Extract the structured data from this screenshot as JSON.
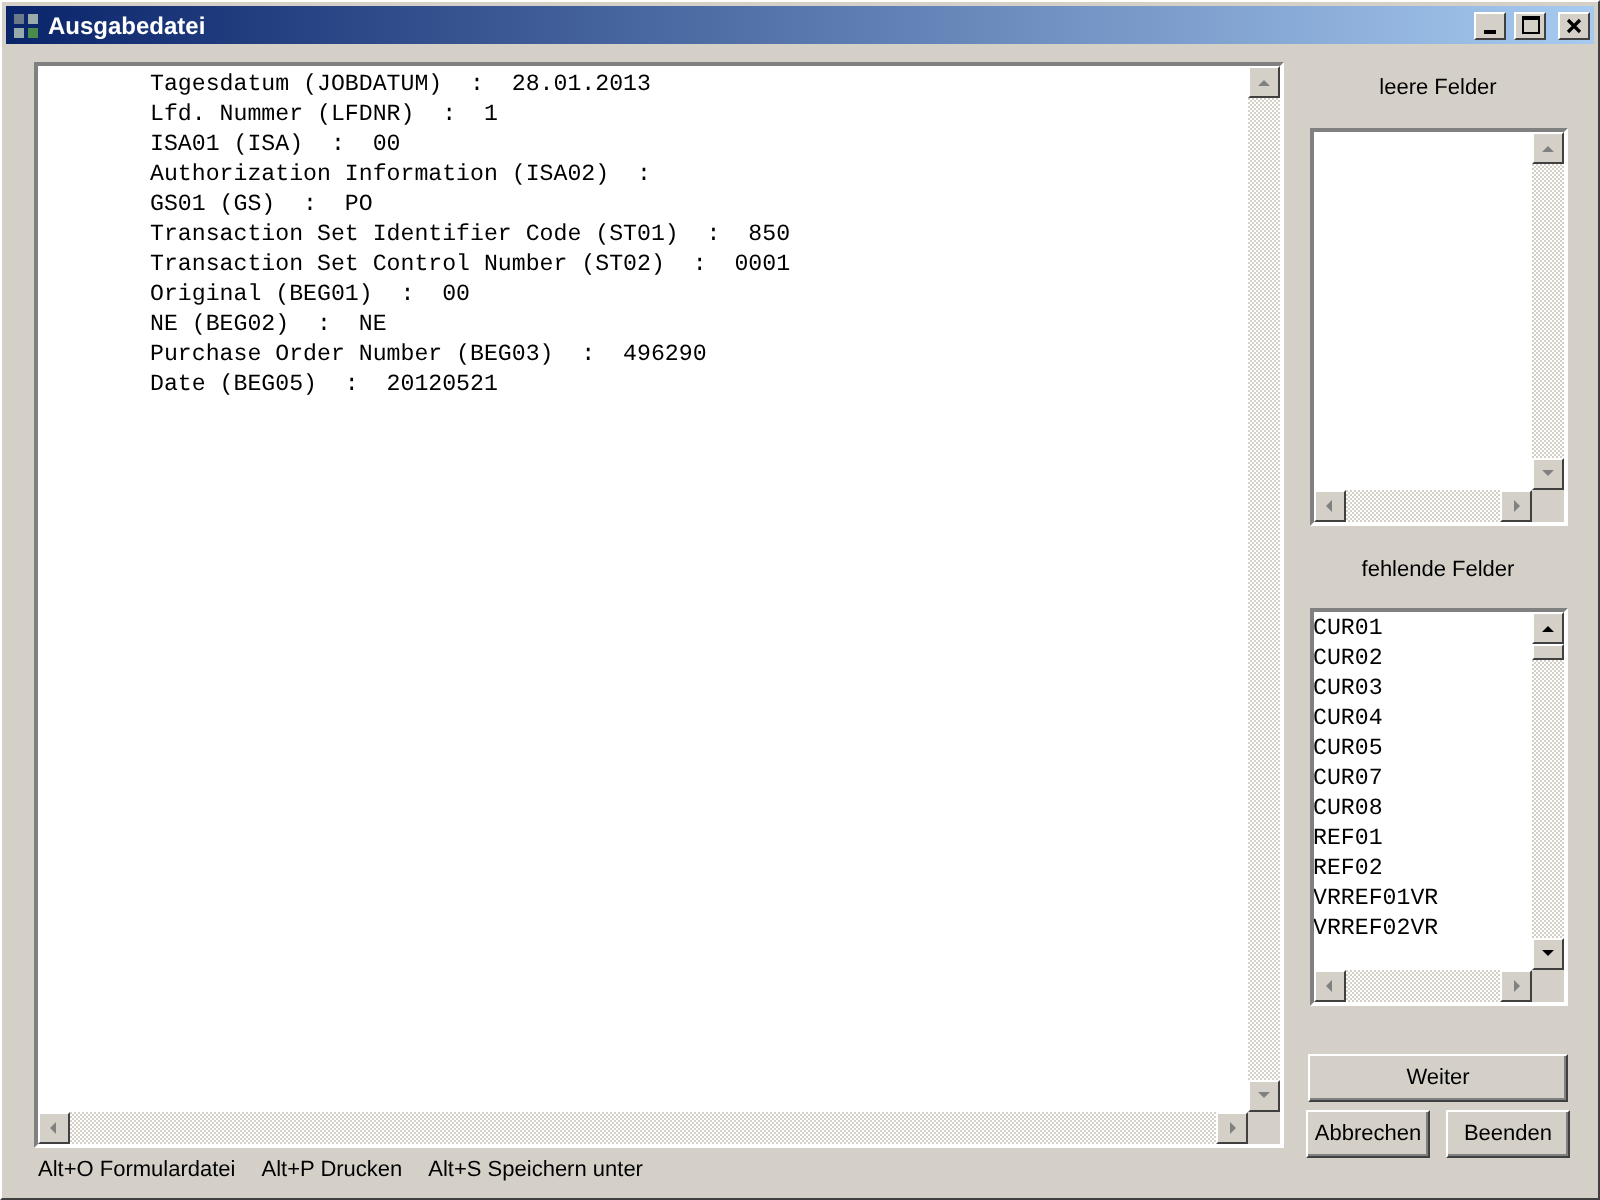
{
  "window": {
    "title": "Ausgabedatei"
  },
  "output_lines": [
    "Tagesdatum (JOBDATUM)  :  28.01.2013",
    "Lfd. Nummer (LFDNR)  :  1",
    "ISA01 (ISA)  :  00",
    "Authorization Information (ISA02)  :",
    "GS01 (GS)  :  PO",
    "Transaction Set Identifier Code (ST01)  :  850",
    "Transaction Set Control Number (ST02)  :  0001",
    "Original (BEG01)  :  00",
    "NE (BEG02)  :  NE",
    "Purchase Order Number (BEG03)  :  496290",
    "Date (BEG05)  :  20120521"
  ],
  "empty_fields": {
    "label": "leere Felder"
  },
  "missing_fields": {
    "label": "fehlende Felder",
    "items": [
      "CUR01",
      "CUR02",
      "CUR03",
      "CUR04",
      "CUR05",
      "CUR07",
      "CUR08",
      "REF01",
      "REF02",
      "VRREF01VR",
      "VRREF02VR"
    ]
  },
  "buttons": [
    "Weiter",
    "Abbrechen",
    "Beenden"
  ],
  "status_bar": [
    "Alt+O Formulardatei",
    "Alt+P Drucken",
    "Alt+S Speichern unter"
  ]
}
